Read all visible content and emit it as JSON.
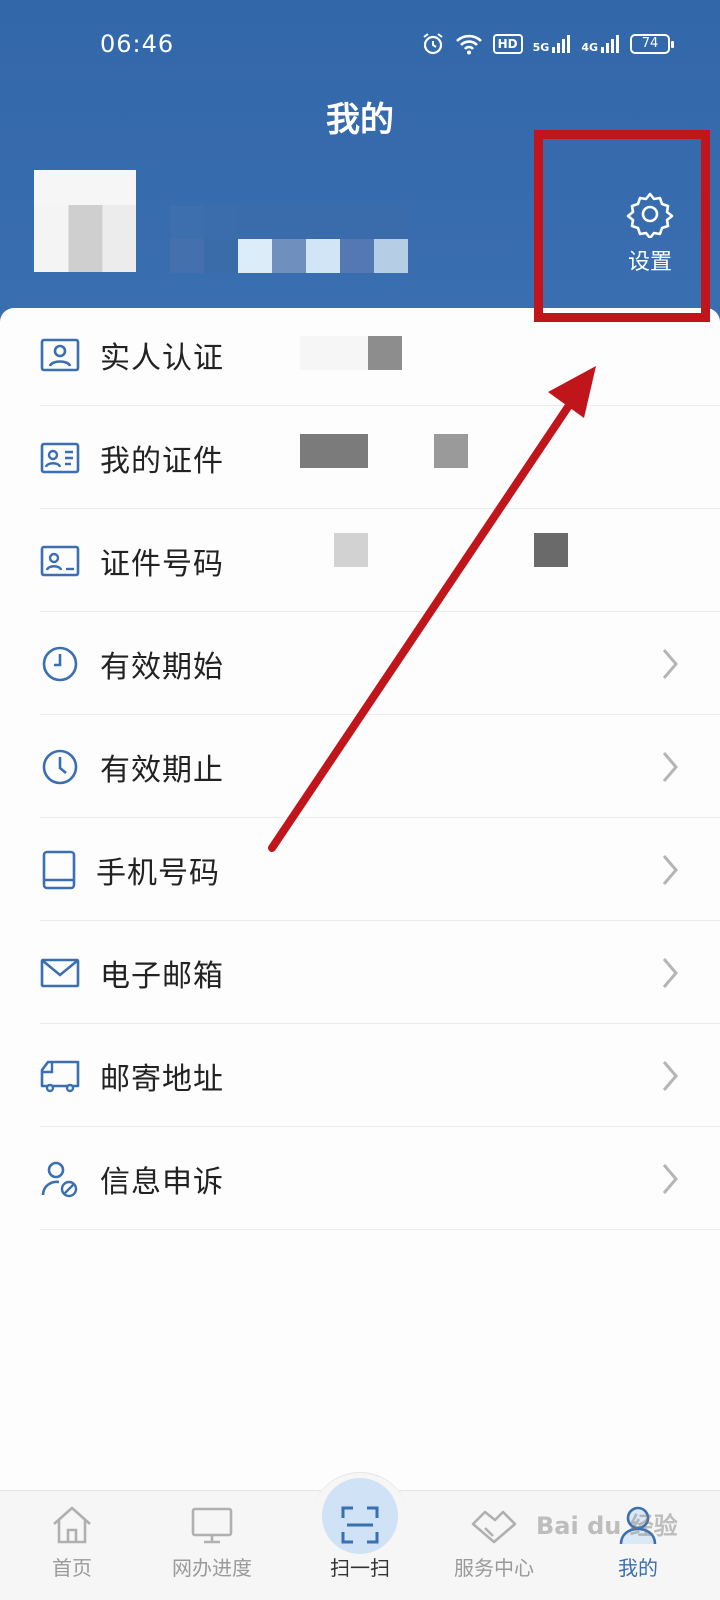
{
  "status_bar": {
    "time": "06:46",
    "network_tags": [
      "HD",
      "5G",
      "4G"
    ],
    "battery": "74"
  },
  "header": {
    "title": "我的",
    "settings_label": "设置"
  },
  "menu": [
    {
      "label": "实人认证",
      "icon": "id-portrait-icon",
      "chevron": false
    },
    {
      "label": "我的证件",
      "icon": "id-card-icon",
      "chevron": false
    },
    {
      "label": "证件号码",
      "icon": "id-number-icon",
      "chevron": false
    },
    {
      "label": "有效期始",
      "icon": "clock-start-icon",
      "chevron": true
    },
    {
      "label": "有效期止",
      "icon": "clock-end-icon",
      "chevron": true
    },
    {
      "label": "手机号码",
      "icon": "tablet-icon",
      "chevron": true
    },
    {
      "label": "电子邮箱",
      "icon": "mail-icon",
      "chevron": true
    },
    {
      "label": "邮寄地址",
      "icon": "truck-icon",
      "chevron": true
    },
    {
      "label": "信息申诉",
      "icon": "user-appeal-icon",
      "chevron": true
    }
  ],
  "tabs": [
    {
      "label": "首页",
      "icon": "home-icon"
    },
    {
      "label": "网办进度",
      "icon": "monitor-icon"
    },
    {
      "label": "扫一扫",
      "icon": "scan-icon"
    },
    {
      "label": "服务中心",
      "icon": "handshake-icon"
    },
    {
      "label": "我的",
      "icon": "person-icon"
    }
  ],
  "watermark": "Bai du 经验",
  "colors": {
    "header_blue": "#3267aa",
    "accent": "#3a6fb1",
    "annotation_red": "#c0161b"
  }
}
